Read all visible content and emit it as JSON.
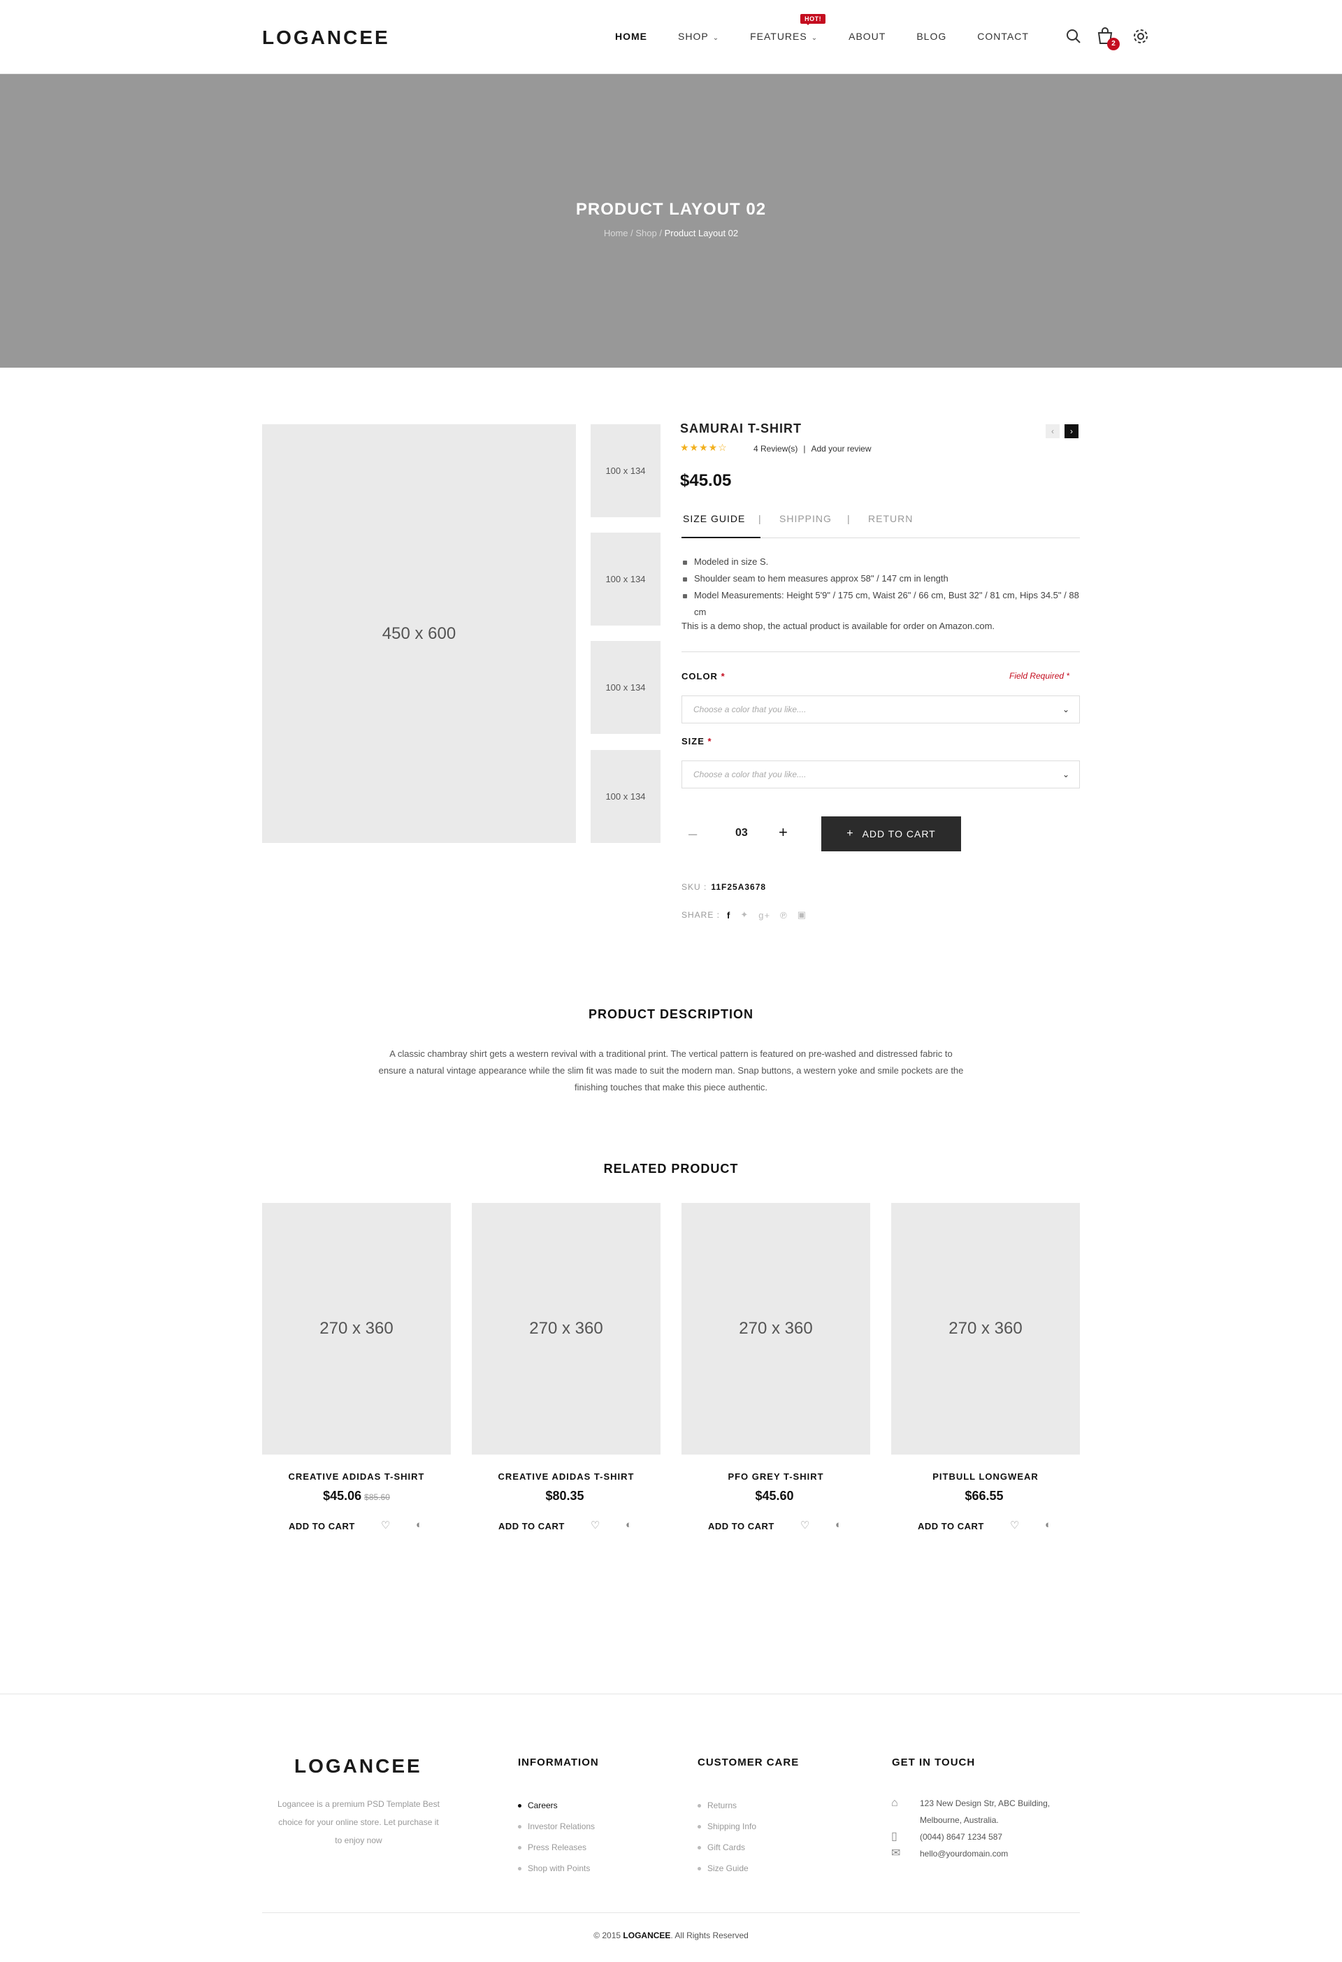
{
  "header": {
    "logo": "LOGANCEE",
    "nav": [
      {
        "label": "HOME"
      },
      {
        "label": "SHOP"
      },
      {
        "label": "FEATURES"
      },
      {
        "label": "ABOUT"
      },
      {
        "label": "BLOG"
      },
      {
        "label": "CONTACT"
      }
    ],
    "hot_badge": "HOT!",
    "cart_count": "2",
    "icons": [
      "search-icon",
      "cart-icon",
      "gear-icon"
    ]
  },
  "hero": {
    "title": "PRODUCT LAYOUT 02",
    "breadcrumb": {
      "home": "Home",
      "shop": "Shop",
      "current": "Product Layout 02"
    }
  },
  "product": {
    "main_image": "450 x 600",
    "thumbs": [
      "100 x 134",
      "100 x 134",
      "100 x 134",
      "100 x 134"
    ],
    "title": "SAMURAI T-SHIRT",
    "rating": 4.5,
    "reviews": "4 Review(s)",
    "add_review": "Add your review",
    "price": "$45.05",
    "tabs": [
      "SIZE GUIDE",
      "SHIPPING",
      "RETURN"
    ],
    "details": [
      "Modeled in size S.",
      "Shoulder seam to hem measures approx 58\" / 147 cm in length",
      "Model Measurements: Height 5'9\" / 175 cm, Waist 26\" / 66 cm, Bust 32\" / 81 cm, Hips 34.5\" / 88 cm"
    ],
    "note": "This is a demo shop, the actual product is available for order on Amazon.com.",
    "color_label": "COLOR",
    "field_required": "Field Required *",
    "color_placeholder": "Choose a color that you like....",
    "size_label": "SIZE",
    "size_placeholder": "Choose a color that you like....",
    "quantity": "03",
    "add_to_cart": "ADD TO CART",
    "sku_label": "SKU :",
    "sku": "11F25A3678",
    "share_label": "SHARE :"
  },
  "description": {
    "title": "PRODUCT DESCRIPTION",
    "text": "A classic chambray shirt gets a western revival with a traditional print. The vertical pattern is featured on pre-washed and distressed fabric to ensure a natural vintage appearance while the slim fit was made to suit the modern man. Snap buttons, a western yoke and smile pockets are the finishing touches that make this piece authentic."
  },
  "related": {
    "title": "RELATED PRODUCT",
    "items": [
      {
        "image": "270 x 360",
        "name": "CREATIVE ADIDAS T-SHIRT",
        "price": "$45.06",
        "old_price": "$85.60",
        "add": "ADD TO CART"
      },
      {
        "image": "270 x 360",
        "name": "CREATIVE ADIDAS T-SHIRT",
        "price": "$80.35",
        "old_price": "",
        "add": "ADD TO CART"
      },
      {
        "image": "270 x 360",
        "name": "PFO GREY T-SHIRT",
        "price": "$45.60",
        "old_price": "",
        "add": "ADD TO CART"
      },
      {
        "image": "270 x 360",
        "name": "PITBULL LONGWEAR",
        "price": "$66.55",
        "old_price": "",
        "add": "ADD TO CART"
      }
    ]
  },
  "footer": {
    "logo": "LOGANCEE",
    "about": "Logancee is a premium PSD Template Best choice for your online store. Let purchase it to enjoy now",
    "information": {
      "title": "INFORMATION",
      "items": [
        "Careers",
        "Investor Relations",
        "Press Releases",
        "Shop with Points"
      ]
    },
    "customer_care": {
      "title": "CUSTOMER CARE",
      "items": [
        "Returns",
        "Shipping Info",
        "Gift Cards",
        "Size Guide"
      ]
    },
    "contact": {
      "title": "GET IN TOUCH",
      "address_line1": "123 New Design Str, ABC Building,",
      "address_line2": "Melbourne, Australia.",
      "phone": "(0044) 8647 1234 587",
      "email": "hello@yourdomain.com"
    },
    "copyright_prefix": "© 2015",
    "copyright_brand": "LOGANCEE",
    "copyright_suffix": ". All Rights Reserved"
  },
  "colors": {
    "accent": "#c40d1f",
    "hero_bg": "#989898",
    "button_dark": "#2b2b2b",
    "star": "#f2b01e"
  }
}
